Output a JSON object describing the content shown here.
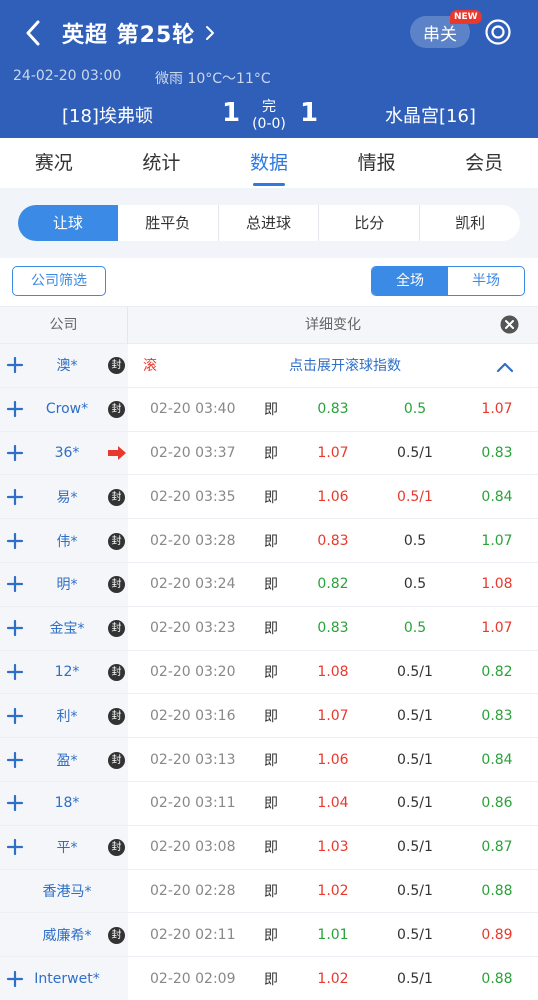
{
  "header": {
    "title": "英超 第25轮",
    "parlay_label": "串关",
    "new_badge": "NEW",
    "datetime": "24-02-20 03:00",
    "weather": "微雨 10°C～11°C",
    "home_team": "[18]埃弗顿",
    "home_score": "1",
    "status": "完",
    "half_score": "(0-0)",
    "away_score": "1",
    "away_team": "水晶宫[16]",
    "bg_color": "#2f5fb8"
  },
  "tabs": [
    "赛况",
    "统计",
    "数据",
    "情报",
    "会员"
  ],
  "active_tab": "数据",
  "subtabs": [
    "让球",
    "胜平负",
    "总进球",
    "比分",
    "凯利"
  ],
  "active_subtab": "让球",
  "filter": {
    "company_filter": "公司筛选",
    "periods": [
      "全场",
      "半场"
    ],
    "active_period": "全场"
  },
  "table_header": {
    "company": "公司",
    "detail": "详细变化"
  },
  "live_row": {
    "company": "澳*",
    "label": "滚",
    "expand_text": "点击展开滚球指数"
  },
  "rows": [
    {
      "company": "Crow*",
      "seal": true,
      "time": "02-20 03:40",
      "type": "即",
      "home": "0.83",
      "home_dir": "down",
      "line": "0.5",
      "line_dir": "down",
      "away": "1.07",
      "away_dir": "up",
      "plus": true
    },
    {
      "company": "36*",
      "arrow": true,
      "time": "02-20 03:37",
      "type": "即",
      "home": "1.07",
      "home_dir": "up",
      "line": "0.5/1",
      "line_dir": "flat",
      "away": "0.83",
      "away_dir": "down",
      "plus": true
    },
    {
      "company": "易*",
      "seal": true,
      "time": "02-20 03:35",
      "type": "即",
      "home": "1.06",
      "home_dir": "up",
      "line": "0.5/1",
      "line_dir": "up",
      "away": "0.84",
      "away_dir": "down",
      "plus": true
    },
    {
      "company": "伟*",
      "seal": true,
      "time": "02-20 03:28",
      "type": "即",
      "home": "0.83",
      "home_dir": "up",
      "line": "0.5",
      "line_dir": "flat",
      "away": "1.07",
      "away_dir": "down",
      "plus": true
    },
    {
      "company": "明*",
      "seal": true,
      "time": "02-20 03:24",
      "type": "即",
      "home": "0.82",
      "home_dir": "down",
      "line": "0.5",
      "line_dir": "flat",
      "away": "1.08",
      "away_dir": "up",
      "plus": true
    },
    {
      "company": "金宝*",
      "seal": true,
      "time": "02-20 03:23",
      "type": "即",
      "home": "0.83",
      "home_dir": "down",
      "line": "0.5",
      "line_dir": "down",
      "away": "1.07",
      "away_dir": "up",
      "plus": true
    },
    {
      "company": "12*",
      "seal": true,
      "time": "02-20 03:20",
      "type": "即",
      "home": "1.08",
      "home_dir": "up",
      "line": "0.5/1",
      "line_dir": "flat",
      "away": "0.82",
      "away_dir": "down",
      "plus": true
    },
    {
      "company": "利*",
      "seal": true,
      "time": "02-20 03:16",
      "type": "即",
      "home": "1.07",
      "home_dir": "up",
      "line": "0.5/1",
      "line_dir": "flat",
      "away": "0.83",
      "away_dir": "down",
      "plus": true
    },
    {
      "company": "盈*",
      "seal": true,
      "time": "02-20 03:13",
      "type": "即",
      "home": "1.06",
      "home_dir": "up",
      "line": "0.5/1",
      "line_dir": "flat",
      "away": "0.84",
      "away_dir": "down",
      "plus": true
    },
    {
      "company": "18*",
      "time": "02-20 03:11",
      "type": "即",
      "home": "1.04",
      "home_dir": "up",
      "line": "0.5/1",
      "line_dir": "flat",
      "away": "0.86",
      "away_dir": "down",
      "plus": true
    },
    {
      "company": "平*",
      "seal": true,
      "time": "02-20 03:08",
      "type": "即",
      "home": "1.03",
      "home_dir": "up",
      "line": "0.5/1",
      "line_dir": "flat",
      "away": "0.87",
      "away_dir": "down",
      "plus": true
    },
    {
      "company": "香港马*",
      "time": "02-20 02:28",
      "type": "即",
      "home": "1.02",
      "home_dir": "up",
      "line": "0.5/1",
      "line_dir": "flat",
      "away": "0.88",
      "away_dir": "down",
      "plus": false
    },
    {
      "company": "威廉希*",
      "seal": true,
      "time": "02-20 02:11",
      "type": "即",
      "home": "1.01",
      "home_dir": "down",
      "line": "0.5/1",
      "line_dir": "flat",
      "away": "0.89",
      "away_dir": "up",
      "plus": false
    },
    {
      "company": "Interwet*",
      "time": "02-20 02:09",
      "type": "即",
      "home": "1.02",
      "home_dir": "up",
      "line": "0.5/1",
      "line_dir": "flat",
      "away": "0.88",
      "away_dir": "down",
      "plus": true
    }
  ],
  "seal_label": "封",
  "colors": {
    "up": "#e8392e",
    "down": "#2aa23a",
    "accent": "#3a8ae6"
  },
  "icons": [
    "back-arrow-icon",
    "chevron-right-icon",
    "settings-icon",
    "close-icon",
    "plus-icon",
    "seal-icon",
    "red-arrow-icon",
    "caret-up-icon"
  ]
}
